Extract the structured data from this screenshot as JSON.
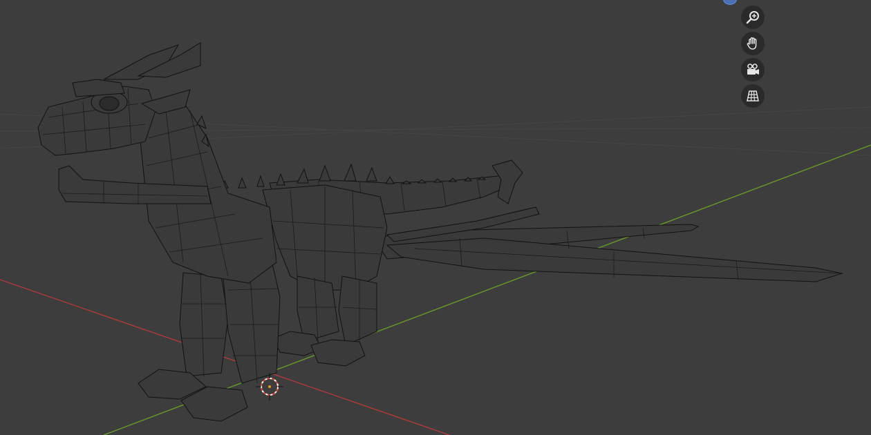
{
  "viewport": {
    "background": "#3d3d3d",
    "x_axis_color": "#b23a3a",
    "y_axis_color": "#6a9a2a",
    "wire_color": "#111111",
    "mesh_fill": "#3a3a3a"
  },
  "navigation": {
    "buttons": [
      {
        "name": "zoom",
        "icon": "zoom-in-icon"
      },
      {
        "name": "pan",
        "icon": "hand-icon"
      },
      {
        "name": "camera",
        "icon": "camera-icon"
      },
      {
        "name": "perspective",
        "icon": "grid-icon"
      }
    ]
  },
  "gizmo": {
    "axis_z_color": "#4a6fb5"
  }
}
